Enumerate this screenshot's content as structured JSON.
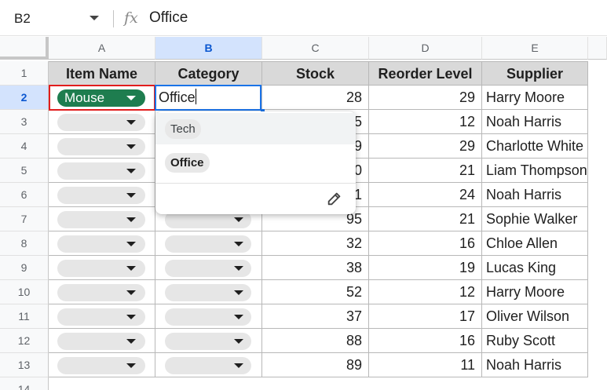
{
  "formula_bar": {
    "cell_ref": "B2",
    "fx": "fx",
    "content": "Office"
  },
  "column_headers": [
    "A",
    "B",
    "C",
    "D",
    "E"
  ],
  "row_headers": [
    "1",
    "2",
    "3",
    "4",
    "5",
    "6",
    "7",
    "8",
    "9",
    "10",
    "11",
    "12",
    "13",
    "14"
  ],
  "table": {
    "headers": [
      "Item Name",
      "Category",
      "Stock",
      "Reorder Level",
      "Supplier"
    ],
    "rows": [
      {
        "item": "Mouse",
        "category": "Office",
        "stock": "28",
        "reorder": "29",
        "supplier": "Harry Moore"
      },
      {
        "item": "",
        "category": "",
        "stock": "5",
        "reorder": "12",
        "supplier": "Noah Harris"
      },
      {
        "item": "",
        "category": "",
        "stock": "9",
        "reorder": "29",
        "supplier": "Charlotte White"
      },
      {
        "item": "",
        "category": "",
        "stock": "0",
        "reorder": "21",
        "supplier": "Liam Thompson"
      },
      {
        "item": "",
        "category": "",
        "stock": "1",
        "reorder": "24",
        "supplier": "Noah Harris"
      },
      {
        "item": "",
        "category": "",
        "stock": "95",
        "reorder": "21",
        "supplier": "Sophie Walker"
      },
      {
        "item": "",
        "category": "",
        "stock": "32",
        "reorder": "16",
        "supplier": "Chloe Allen"
      },
      {
        "item": "",
        "category": "",
        "stock": "38",
        "reorder": "19",
        "supplier": "Lucas King"
      },
      {
        "item": "",
        "category": "",
        "stock": "52",
        "reorder": "12",
        "supplier": "Harry Moore"
      },
      {
        "item": "",
        "category": "",
        "stock": "37",
        "reorder": "17",
        "supplier": "Oliver Wilson"
      },
      {
        "item": "",
        "category": "",
        "stock": "88",
        "reorder": "16",
        "supplier": "Ruby Scott"
      },
      {
        "item": "",
        "category": "",
        "stock": "89",
        "reorder": "11",
        "supplier": "Noah Harris"
      }
    ]
  },
  "dropdown": {
    "options": [
      "Tech",
      "Office"
    ],
    "highlighted": "Tech",
    "selected": "Office",
    "edit_icon": "pencil-icon"
  },
  "colors": {
    "chip_selected": "#1e7d4f",
    "header_fill": "#d9d9d9",
    "selection": "#1a73e8",
    "highlight_box": "#e11d1d"
  }
}
